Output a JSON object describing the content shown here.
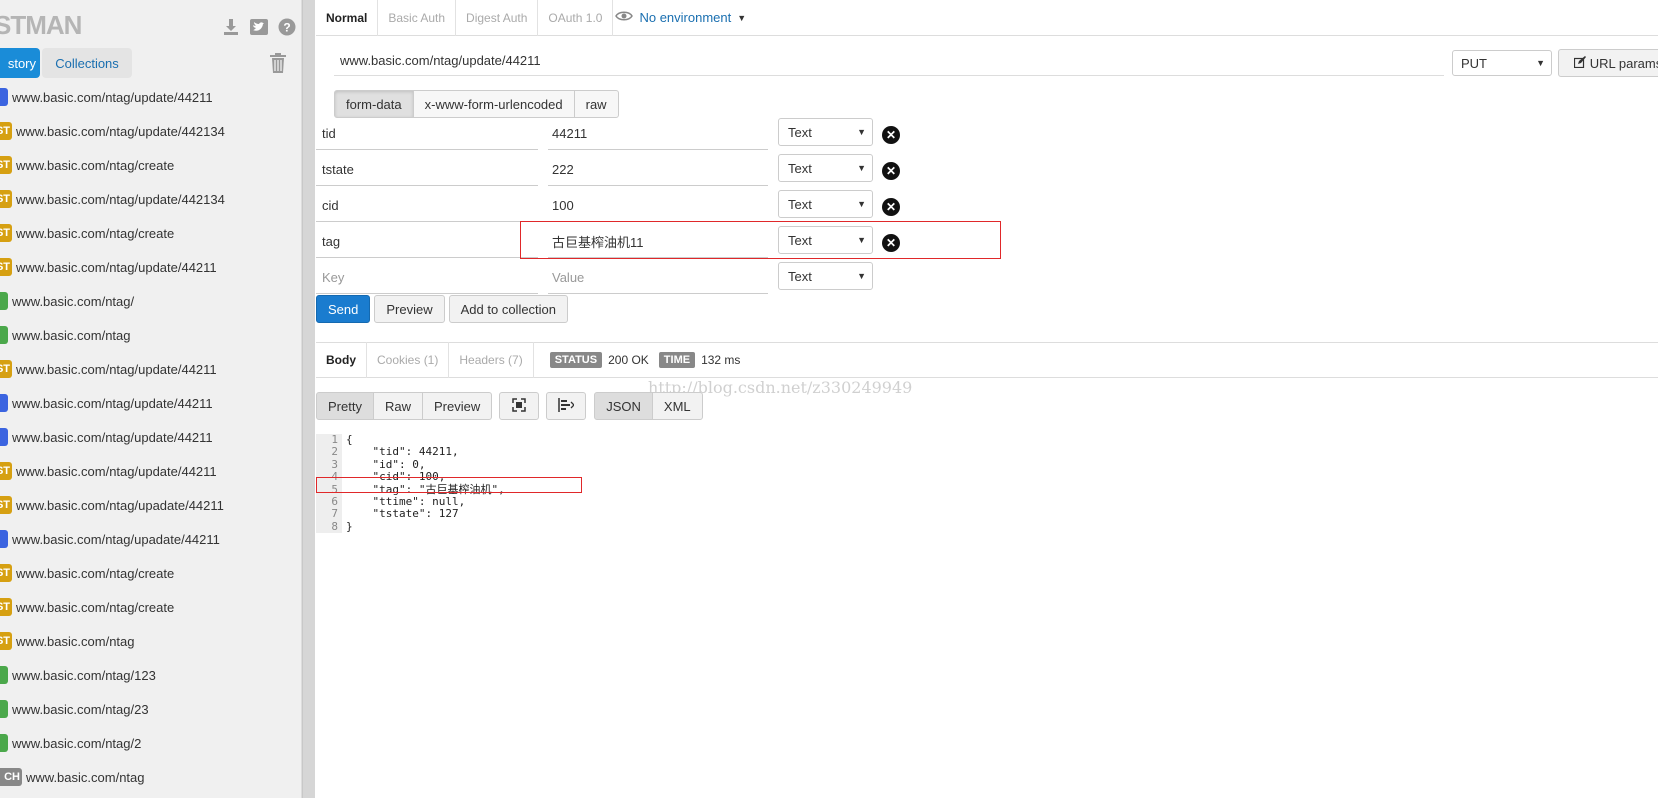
{
  "sidebar": {
    "brand": "STMAN",
    "tabs": {
      "history": "story",
      "collections": "Collections"
    },
    "history": [
      {
        "method": "put",
        "label": "",
        "url": "www.basic.com/ntag/update/44211"
      },
      {
        "method": "post",
        "label": "ST",
        "url": "www.basic.com/ntag/update/442134"
      },
      {
        "method": "post",
        "label": "ST",
        "url": "www.basic.com/ntag/create"
      },
      {
        "method": "post",
        "label": "ST",
        "url": "www.basic.com/ntag/update/442134"
      },
      {
        "method": "post",
        "label": "ST",
        "url": "www.basic.com/ntag/create"
      },
      {
        "method": "post",
        "label": "ST",
        "url": "www.basic.com/ntag/update/44211"
      },
      {
        "method": "get",
        "label": "",
        "url": "www.basic.com/ntag/"
      },
      {
        "method": "get",
        "label": "",
        "url": "www.basic.com/ntag"
      },
      {
        "method": "post",
        "label": "ST",
        "url": "www.basic.com/ntag/update/44211"
      },
      {
        "method": "put",
        "label": "",
        "url": "www.basic.com/ntag/update/44211"
      },
      {
        "method": "put",
        "label": "",
        "url": "www.basic.com/ntag/update/44211"
      },
      {
        "method": "post",
        "label": "ST",
        "url": "www.basic.com/ntag/update/44211"
      },
      {
        "method": "post",
        "label": "ST",
        "url": "www.basic.com/ntag/upadate/44211"
      },
      {
        "method": "put",
        "label": "",
        "url": "www.basic.com/ntag/upadate/44211"
      },
      {
        "method": "post",
        "label": "ST",
        "url": "www.basic.com/ntag/create"
      },
      {
        "method": "post",
        "label": "ST",
        "url": "www.basic.com/ntag/create"
      },
      {
        "method": "post",
        "label": "ST",
        "url": "www.basic.com/ntag"
      },
      {
        "method": "get",
        "label": "",
        "url": "www.basic.com/ntag/123"
      },
      {
        "method": "get",
        "label": "",
        "url": "www.basic.com/ntag/23"
      },
      {
        "method": "get",
        "label": "",
        "url": "www.basic.com/ntag/2"
      },
      {
        "method": "patch",
        "label": "CH",
        "url": "www.basic.com/ntag"
      }
    ]
  },
  "auth_tabs": [
    "Normal",
    "Basic Auth",
    "Digest Auth",
    "OAuth 1.0"
  ],
  "environment": "No environment",
  "request": {
    "url": "www.basic.com/ntag/update/44211",
    "method": "PUT",
    "url_params": "URL params"
  },
  "body_tabs": [
    "form-data",
    "x-www-form-urlencoded",
    "raw"
  ],
  "form_rows": [
    {
      "key": "tid",
      "value": "44211",
      "type": "Text"
    },
    {
      "key": "tstate",
      "value": "222",
      "type": "Text"
    },
    {
      "key": "cid",
      "value": "100",
      "type": "Text"
    },
    {
      "key": "tag",
      "value": "古巨基榨油机11",
      "type": "Text"
    }
  ],
  "new_row": {
    "key_placeholder": "Key",
    "value_placeholder": "Value",
    "type": "Text"
  },
  "actions": {
    "send": "Send",
    "preview": "Preview",
    "add": "Add to collection"
  },
  "response": {
    "tabs": [
      "Body",
      "Cookies (1)",
      "Headers (7)"
    ],
    "status_label": "STATUS",
    "status": "200 OK",
    "time_label": "TIME",
    "time": "132 ms",
    "watermark": "http://blog.csdn.net/z330249949",
    "view_modes": [
      "Pretty",
      "Raw",
      "Preview"
    ],
    "formats": [
      "JSON",
      "XML"
    ],
    "line_numbers": [
      "1",
      "2",
      "3",
      "4",
      "5",
      "6",
      "7",
      "8"
    ],
    "code": "{\n    \"tid\": 44211,\n    \"id\": 0,\n    \"cid\": 100,\n    \"tag\": \"古巨基榨油机\",\n    \"ttime\": null,\n    \"tstate\": 127\n}"
  },
  "colors": {
    "accent": "#1a8cd8",
    "send": "#1a7ccf",
    "highlight": "#e0282a",
    "post": "#d6a012",
    "get": "#4ba84b",
    "put": "#3b64e0"
  }
}
